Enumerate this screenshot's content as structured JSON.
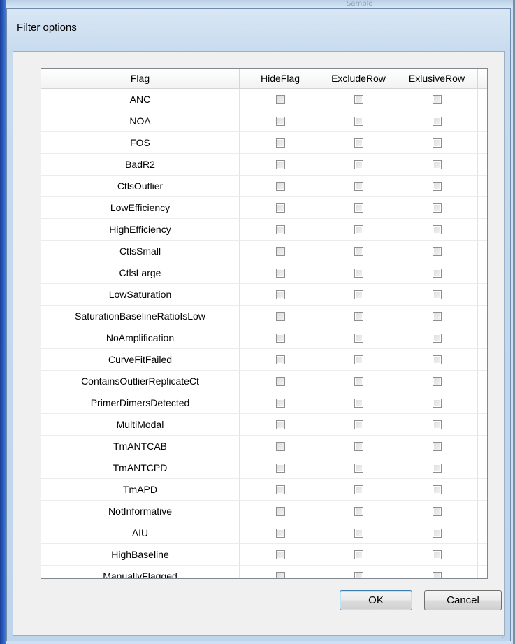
{
  "dialog": {
    "title": "Filter options",
    "ok_label": "OK",
    "cancel_label": "Cancel"
  },
  "background": {
    "ghost_text": [
      "Sample"
    ]
  },
  "grid": {
    "columns": [
      "Flag",
      "HideFlag",
      "ExcludeRow",
      "ExlusiveRow"
    ],
    "rows": [
      {
        "flag": "ANC",
        "hide": false,
        "exclude": false,
        "exclusive": false
      },
      {
        "flag": "NOA",
        "hide": false,
        "exclude": false,
        "exclusive": false
      },
      {
        "flag": "FOS",
        "hide": false,
        "exclude": false,
        "exclusive": false
      },
      {
        "flag": "BadR2",
        "hide": false,
        "exclude": false,
        "exclusive": false
      },
      {
        "flag": "CtlsOutlier",
        "hide": false,
        "exclude": false,
        "exclusive": false
      },
      {
        "flag": "LowEfficiency",
        "hide": false,
        "exclude": false,
        "exclusive": false
      },
      {
        "flag": "HighEfficiency",
        "hide": false,
        "exclude": false,
        "exclusive": false
      },
      {
        "flag": "CtlsSmall",
        "hide": false,
        "exclude": false,
        "exclusive": false
      },
      {
        "flag": "CtlsLarge",
        "hide": false,
        "exclude": false,
        "exclusive": false
      },
      {
        "flag": "LowSaturation",
        "hide": false,
        "exclude": false,
        "exclusive": false
      },
      {
        "flag": "SaturationBaselineRatioIsLow",
        "hide": false,
        "exclude": false,
        "exclusive": false
      },
      {
        "flag": "NoAmplification",
        "hide": false,
        "exclude": false,
        "exclusive": false
      },
      {
        "flag": "CurveFitFailed",
        "hide": false,
        "exclude": false,
        "exclusive": false
      },
      {
        "flag": "ContainsOutlierReplicateCt",
        "hide": false,
        "exclude": false,
        "exclusive": false
      },
      {
        "flag": "PrimerDimersDetected",
        "hide": false,
        "exclude": false,
        "exclusive": false
      },
      {
        "flag": "MultiModal",
        "hide": false,
        "exclude": false,
        "exclusive": false
      },
      {
        "flag": "TmANTCAB",
        "hide": false,
        "exclude": false,
        "exclusive": false
      },
      {
        "flag": "TmANTCPD",
        "hide": false,
        "exclude": false,
        "exclusive": false
      },
      {
        "flag": "TmAPD",
        "hide": false,
        "exclude": false,
        "exclusive": false
      },
      {
        "flag": "NotInformative",
        "hide": false,
        "exclude": false,
        "exclusive": false
      },
      {
        "flag": "AIU",
        "hide": false,
        "exclude": false,
        "exclusive": false
      },
      {
        "flag": "HighBaseline",
        "hide": false,
        "exclude": false,
        "exclusive": false
      },
      {
        "flag": "ManuallyFlagged",
        "hide": false,
        "exclude": false,
        "exclusive": false
      }
    ]
  },
  "colors": {
    "titlebar": "#c8dbee",
    "left_accent": "#2b61c9",
    "grid_border": "#828790",
    "default_button_border": "#3c7fb1"
  },
  "icons": {
    "resize_grip": "resize-grip-icon"
  }
}
